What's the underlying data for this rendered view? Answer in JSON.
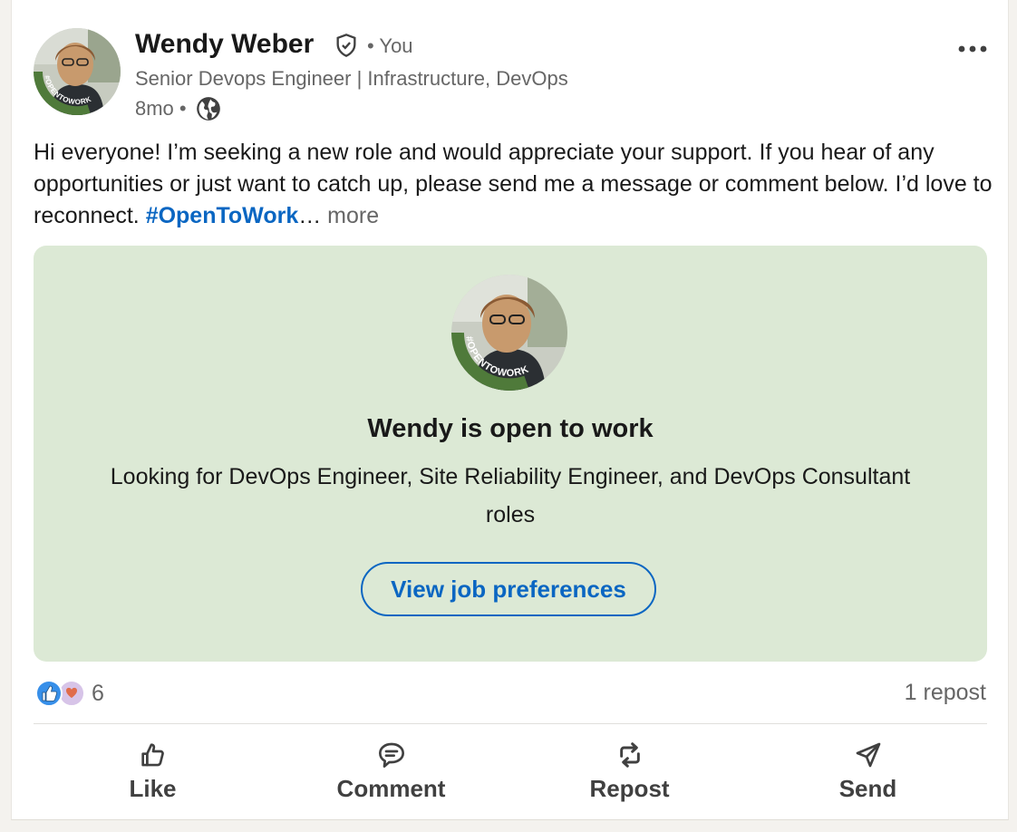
{
  "post": {
    "author": {
      "name": "Wendy Weber",
      "relation": "• You",
      "headline": "Senior Devops Engineer | Infrastructure, DevOps",
      "time": "8mo •",
      "badge_text": "#OPENTOWORK"
    },
    "text": {
      "body": "Hi everyone! I’m seeking a new role and would appreciate your support. If you hear of any opportunities or just want to catch up, please send me a message or comment below. I’d love to reconnect. ",
      "hashtag": "#OpenToWork",
      "ellipsis": "…",
      "see_more": "more"
    }
  },
  "open_to_work": {
    "title": "Wendy is open to work",
    "description": "Looking for DevOps Engineer, Site Reliability Engineer, and DevOps Consultant roles",
    "button": "View job preferences",
    "badge_text": "#OPENTOWORK"
  },
  "social": {
    "reaction_count": "6",
    "repost_count": "1 repost"
  },
  "actions": {
    "like": "Like",
    "comment": "Comment",
    "repost": "Repost",
    "send": "Send"
  },
  "colors": {
    "brand_blue": "#0a66c2",
    "open_to_work_green": "#4f7a3a",
    "card_green": "#dce9d5",
    "muted_text": "#666666"
  },
  "icons": {
    "verified": "verified-shield-icon",
    "visibility": "globe-icon",
    "menu": "more-options-icon",
    "like": "thumbs-up-icon",
    "comment": "comment-bubble-icon",
    "repost": "repost-arrows-icon",
    "send": "send-plane-icon"
  }
}
